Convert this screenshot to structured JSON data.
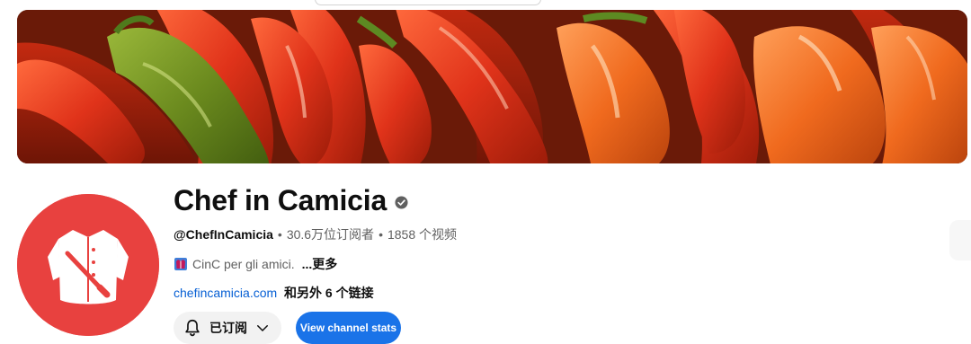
{
  "channel": {
    "name": "Chef in Camicia",
    "handle": "@ChefInCamicia",
    "subscribers": "30.6万位订阅者",
    "video_count": "1858 个视频",
    "description": "CinC per gli amici.",
    "more_label": "...更多",
    "website": "chefincamicia.com",
    "more_links": "和另外 6 个链接"
  },
  "buttons": {
    "subscribed_label": "已订阅",
    "stats_label": "View channel stats"
  },
  "colors": {
    "avatar_bg": "#e8413f",
    "stats_button": "#1a73e8",
    "link": "#065fd4"
  },
  "icons": {
    "verified": "verified-check-icon",
    "bell": "bell-icon",
    "chevron": "chevron-down-icon",
    "description_emoji": "shirt-emoji-icon"
  }
}
